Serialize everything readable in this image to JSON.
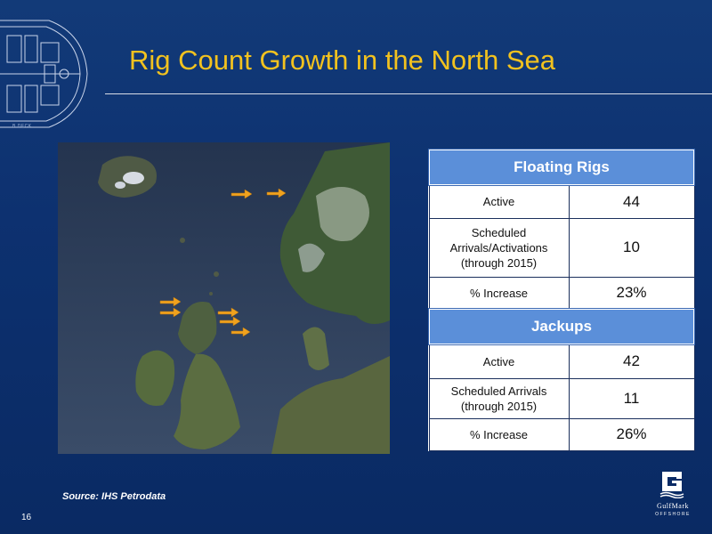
{
  "slide": {
    "title": "Rig Count Growth in the North Sea",
    "page_number": "16",
    "source": "Source: IHS Petrodata",
    "deck_caption": "B DECK"
  },
  "logo": {
    "letter": "G",
    "name": "GulfMark",
    "subtitle": "OFFSHORE"
  },
  "map": {
    "icon": "north-sea-satellite-map",
    "marker_icon": "rig-arrow-icon",
    "marker_color": "#f0a21e"
  },
  "floating_rigs": {
    "heading": "Floating Rigs",
    "rows": [
      {
        "label": "Active",
        "value": "44"
      },
      {
        "label": "Scheduled Arrivals/Activations (through 2015)",
        "value": "10"
      },
      {
        "label": "% Increase",
        "value": "23%"
      }
    ]
  },
  "jackups": {
    "heading": "Jackups",
    "rows": [
      {
        "label": "Active",
        "value": "42"
      },
      {
        "label": "Scheduled Arrivals (through 2015)",
        "value": "11"
      },
      {
        "label": "% Increase",
        "value": "26%"
      }
    ]
  },
  "colors": {
    "background": "#0d3170",
    "title": "#f2c21f",
    "table_header": "#5b8fd9"
  }
}
